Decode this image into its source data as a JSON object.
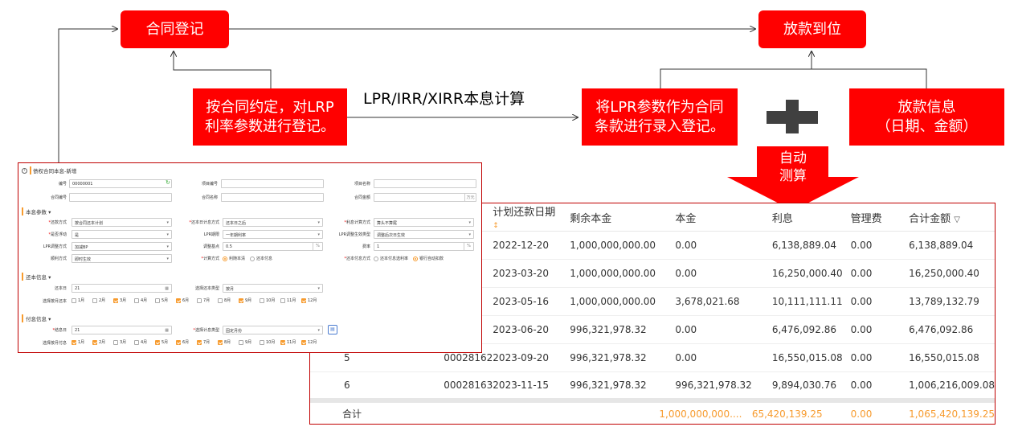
{
  "flow": {
    "contract_register": "合同登记",
    "disbursement": "放款到位",
    "register_note": "按合同约定，对LRP\n利率参数进行登记。",
    "calc_label": "LPR/IRR/XIRR本息计算",
    "input_note": "将LPR参数作为合同\n条款进行录入登记。",
    "loan_info": "放款信息\n（日期、金额）",
    "auto_calc": "自动\n测算"
  },
  "colors": {
    "accent_red": "#ff0000",
    "orange": "#f79b2e",
    "plus_gray": "#404040"
  },
  "table": {
    "columns": [
      "",
      "",
      "计划还款日期",
      "剩余本金",
      "本金",
      "利息",
      "管理费",
      "合计金额"
    ],
    "rows": [
      [
        "",
        "",
        "2022-12-20",
        "1,000,000,000.00",
        "0.00",
        "6,138,889.04",
        "0.00",
        "6,138,889.04"
      ],
      [
        "",
        "",
        "2023-03-20",
        "1,000,000,000.00",
        "0.00",
        "16,250,000.40",
        "0.00",
        "16,250,000.40"
      ],
      [
        "",
        "",
        "2023-05-16",
        "1,000,000,000.00",
        "3,678,021.68",
        "10,111,111.11",
        "0.00",
        "13,789,132.79"
      ],
      [
        "",
        "",
        "2023-06-20",
        "996,321,978.32",
        "0.00",
        "6,476,092.86",
        "0.00",
        "6,476,092.86"
      ],
      [
        "5",
        "00028162",
        "2023-09-20",
        "996,321,978.32",
        "0.00",
        "16,550,015.08",
        "0.00",
        "16,550,015.08"
      ],
      [
        "6",
        "00028163",
        "2023-11-15",
        "996,321,978.32",
        "996,321,978.32",
        "9,894,030.76",
        "0.00",
        "1,006,216,009.08"
      ]
    ],
    "total": {
      "label": "合计",
      "principal": "1,000,000,000....",
      "interest": "65,420,139.25",
      "fee": "0.00",
      "sum": "1,065,420,139.25"
    }
  },
  "form": {
    "title": "债权合同本息-新增",
    "row1": {
      "l1": "编号",
      "v1": "00000001",
      "l2": "项目编号",
      "l3": "项目名称"
    },
    "row2": {
      "l1": "合同编号",
      "l2": "合同名称",
      "l3": "合同金额",
      "suffix": "万元"
    },
    "sec1": "本息参数",
    "p1": {
      "l1": "还款方式",
      "v1": "按合同还本计划",
      "l2": "还本日计息方式",
      "v2": "还本日之后",
      "l3": "利息计算方式",
      "v3": "算头不算尾"
    },
    "p2": {
      "l1": "是否浮动",
      "v1": "是",
      "l2": "LPR期限",
      "v2": "一年期利率",
      "l3": "LPR调整生效类型",
      "v3": "调整后次日生效"
    },
    "p3": {
      "l1": "LPR调整方式",
      "v1": "加减BP",
      "l2": "调整基点",
      "v2": "0.5",
      "v2s": "%",
      "l3": "费率",
      "v3": "1",
      "v3s": "%"
    },
    "p4": {
      "l1": "顺利方式",
      "v1": "即时生效",
      "l2": "计算方式",
      "r1": "利随本清",
      "r2": "还本付息",
      "l3": "还本付息方式",
      "r3": "还本付息选利率",
      "r4": "银行自动扣款"
    },
    "sec2": "还本信息",
    "h1": {
      "l1": "还本日",
      "v1": "21",
      "l2": "选择还本类型",
      "v2": "按月"
    },
    "h2": {
      "l1": "选择按月还本"
    },
    "sec3": "付息信息",
    "i1": {
      "l1": "结息日",
      "v1": "21",
      "l2": "选择计息类型",
      "v2": "固定月份"
    },
    "i2": {
      "l1": "选择按月付息"
    },
    "months": [
      "1月",
      "2月",
      "3月",
      "4月",
      "5月",
      "6月",
      "7月",
      "8月",
      "9月",
      "10月",
      "11月",
      "12月"
    ],
    "repay_months_checked": [
      false,
      false,
      true,
      false,
      false,
      true,
      false,
      false,
      true,
      false,
      false,
      true
    ],
    "interest_months_checked": [
      true,
      true,
      false,
      false,
      true,
      true,
      true,
      true,
      false,
      false,
      true,
      true
    ]
  }
}
